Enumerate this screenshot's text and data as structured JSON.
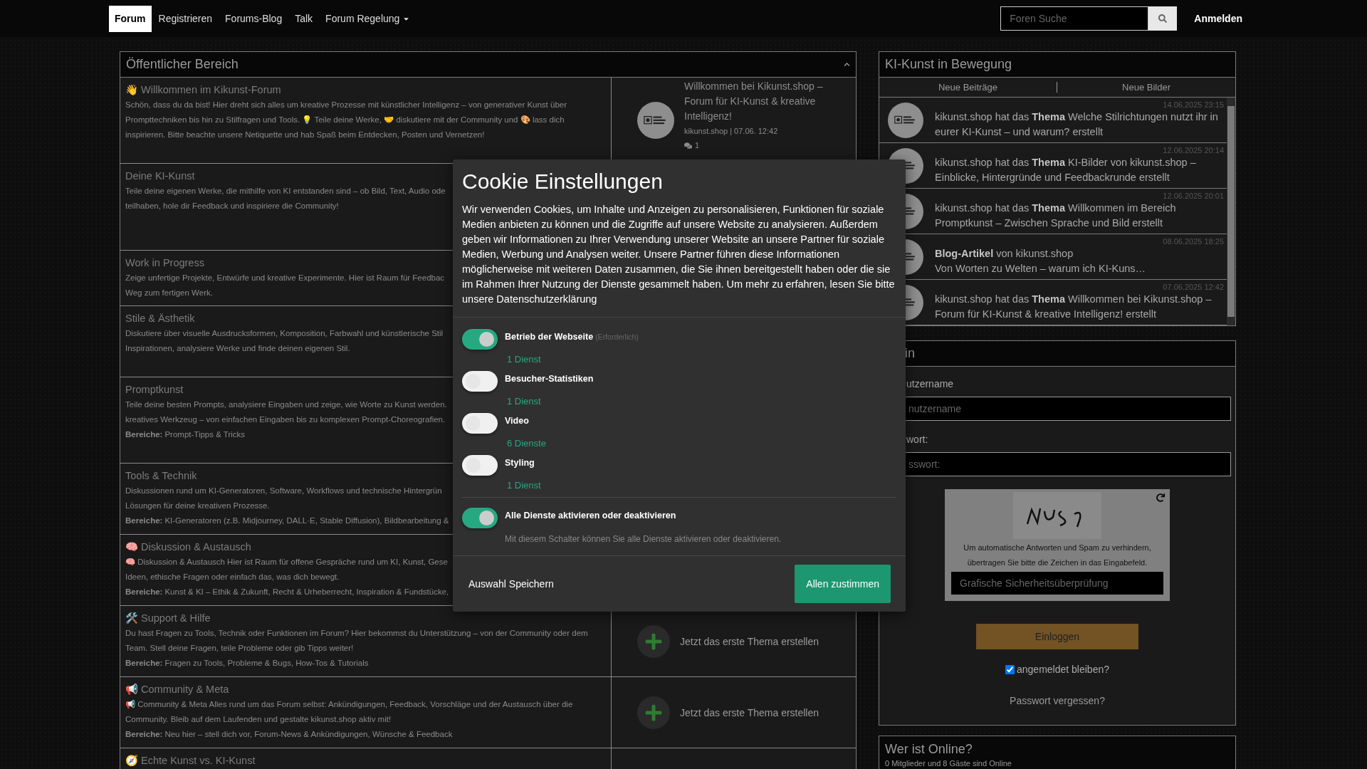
{
  "nav": {
    "items": [
      {
        "label": "Forum",
        "selected": true,
        "dropdown": false
      },
      {
        "label": "Registrieren",
        "selected": false,
        "dropdown": false
      },
      {
        "label": "Forums-Blog",
        "selected": false,
        "dropdown": false
      },
      {
        "label": "Talk",
        "selected": false,
        "dropdown": false
      },
      {
        "label": "Forum Regelung",
        "selected": false,
        "dropdown": true
      }
    ],
    "search": {
      "placeholder": "Foren Suche"
    },
    "login": "Anmelden"
  },
  "forum": {
    "title": "Öffentlicher Bereich",
    "rows": [
      {
        "title": "👋 Willkommen im Kikunst-Forum",
        "lines": [
          "Schön, dass du da bist! Hier dreht sich alles um kreative Prozesse mit künstlicher Intelligenz – von generativer Kunst über",
          "Prompttechniken bis hin zu Stilfragen und Tools. 💡 Teile deine Werke, 🤝 diskutiere mit der Community und 🎨 lass dich",
          "inspirieren. Bitte beachte unsere Netiquette und hab Spaß beim Entdecken, Posten und Vernetzen!"
        ],
        "latest": {
          "kind": "post",
          "title": "Willkommen bei Kikunst.shop – Forum für KI-Kunst & kreative Intelligenz!",
          "meta": "kikunst.shop | 07.06. 12:42",
          "count": "1"
        }
      },
      {
        "title": "Deine KI-Kunst",
        "lines": [
          "Teile deine eigenen Werke, die mithilfe von KI entstanden sind – ob Bild, Text, Audio ode",
          "teilhaben, hole dir Feedback und inspiriere die Community!"
        ]
      },
      {
        "title": "Work in Progress",
        "lines": [
          "Zeige unfertige Projekte, Entwürfe und kreative Experimente. Hier ist Raum für Feedbac",
          "Weg zum fertigen Werk."
        ]
      },
      {
        "title": "Stile & Ästhetik",
        "lines": [
          "Diskutiere über visuelle Ausdrucksformen, Komposition, Farbwahl und künstlerische Stil",
          "Inspirationen, analysiere Werke und finde deinen eigenen Stil."
        ]
      },
      {
        "title": "Promptkunst",
        "lines": [
          "Teile deine besten Prompts, analysiere Eingaben und zeige, wie Worte zu Kunst werden.",
          "kreatives Werkzeug – von einfachen Eingaben bis zu komplexen Prompt-Choreografien."
        ],
        "areas_label": "Bereiche:",
        "areas": "Prompt-Tipps & Tricks"
      },
      {
        "title": "Tools & Technik",
        "lines": [
          "Diskussionen rund um KI-Generatoren, Software, Workflows und technische Hintergrün",
          "Lösungen für deine kreativen Prozesse."
        ],
        "areas_label": "Bereiche:",
        "areas": "KI-Generatoren (z.B. Midjourney, DALL·E, Stable Diffusion), Bildbearbeitung &"
      },
      {
        "title": "🧠 Diskussion & Austausch",
        "lines": [
          "🧠 Diskussion & Austausch Hier ist Raum für offene Gespräche rund um KI, Kunst, Gese",
          "Ideen, ethische Fragen oder einfach das, was dich bewegt."
        ],
        "areas_label": "Bereiche:",
        "areas": "Kunst & KI – Ethik & Zukunft, Recht & Urheberrecht, Inspiration & Fundstücke,"
      },
      {
        "title": "🛠️ Support & Hilfe",
        "lines": [
          "Du hast Fragen zu Tools, Technik oder Funktionen im Forum? Hier bekommst du Unterstützung – von der Community oder dem",
          "Team. Stell deine Fragen, teile Probleme oder gib Tipps weiter!"
        ],
        "areas_label": "Bereiche:",
        "areas": "Fragen zu Tools, Probleme & Bugs, How-Tos & Tutorials",
        "latest": {
          "kind": "empty",
          "text": "Jetzt das erste Thema erstellen"
        }
      },
      {
        "title": "📢 Community & Meta",
        "lines": [
          "📢 Community & Meta Alles rund um das Forum selbst: Ankündigungen, Feedback, Vorschläge und der Austausch über die",
          "Community. Bleib auf dem Laufenden und gestalte kikunst.shop aktiv mit!"
        ],
        "areas_label": "Bereiche:",
        "areas": "Neu hier – stell dich vor, Forum-News & Ankündigungen, Wünsche & Feedback",
        "latest": {
          "kind": "empty",
          "text": "Jetzt das erste Thema erstellen"
        }
      },
      {
        "title": "🧭 Echte Kunst vs. KI-Kunst",
        "lines": []
      }
    ]
  },
  "activity": {
    "title": "KI-Kunst in Bewegung",
    "tabs": [
      "Neue Beiträge",
      "Neue Bilder"
    ],
    "items": [
      {
        "kind": "topic",
        "date": "14.06.2025 23:15",
        "text": "kikunst.shop hat das **Thema** Welche Stilrichtungen nutzt ihr in eurer KI-Kunst – und warum? erstellt"
      },
      {
        "kind": "topic",
        "date": "12.06.2025 20:14",
        "text": "kikunst.shop hat das **Thema** KI-Bilder von kikunst.shop – Einblicke, Hintergründe und Feedbackrunde erstellt"
      },
      {
        "kind": "topic",
        "date": "12.06.2025 20:01",
        "text": "kikunst.shop hat das **Thema** Willkommen im Bereich Promptkunst – Zwischen Sprache und Bild erstellt"
      },
      {
        "kind": "blog",
        "date": "08.06.2025 18:25",
        "text": "**Blog-Artikel** von kikunst.shop",
        "excerpt": "Von Worten zu Welten – warum ich KI-Kuns…"
      },
      {
        "kind": "topic",
        "date": "07.06.2025 12:42",
        "text": "kikunst.shop hat das **Thema** Willkommen bei Kikunst.shop – Forum für KI-Kunst & kreative Intelligenz! erstellt"
      }
    ]
  },
  "login": {
    "title": "in",
    "username_label": "utzername",
    "username_placeholder": "nutzername",
    "password_label": "wort:",
    "password_placeholder": "sswort:",
    "captcha": {
      "hint": "Um automatische Antworten und Spam zu verhindern, übertragen Sie bitte die Zeichen in das Eingabefeld.",
      "placeholder": "Grafische Sicherheitsüberprüfung"
    },
    "submit": "Einloggen",
    "remember": {
      "label": "angemeldet bleiben?",
      "checked": true
    },
    "forgot": "Passwort vergessen?"
  },
  "online": {
    "title": "Wer ist Online?",
    "text": "0 Mitglieder und 8 Gäste sind Online"
  },
  "cookie_dialog": {
    "title": "Cookie Einstellungen",
    "text": "Wir verwenden Cookies, um Inhalte und Anzeigen zu personalisieren, Funktionen für soziale Medien anbieten zu können und die Zugriffe auf unsere Website zu analysieren. Außerdem geben wir Informationen zu Ihrer Verwendung unserer Website an unsere Partner für soziale Medien, Werbung und Analysen weiter. Unsere Partner führen diese Informationen möglicherweise mit weiteren Daten zusammen, die Sie ihnen bereitgestellt haben oder die sie im Rahmen Ihrer Nutzung der Dienste gesammelt haben. Um mehr zu erfahren, lesen Sie bitte unsere Datenschutzerklärung",
    "services": [
      {
        "name": "Betrieb der Webseite",
        "note": "(Erforderlich)",
        "count": "1 Dienst",
        "on": true
      },
      {
        "name": "Besucher-Statistiken",
        "count": "1 Dienst",
        "on": false
      },
      {
        "name": "Video",
        "count": "6 Dienste",
        "on": false
      },
      {
        "name": "Styling",
        "count": "1 Dienst",
        "on": false
      }
    ],
    "all": {
      "name": "Alle Dienste aktivieren oder deaktivieren",
      "description": "Mit diesem Schalter können Sie alle Dienste aktivieren oder deaktivieren.",
      "on": true
    },
    "buttons": [
      {
        "kind": "link",
        "label": "Auswahl Speichern"
      },
      {
        "kind": "primary",
        "label": "Allen zustimmen"
      }
    ]
  }
}
